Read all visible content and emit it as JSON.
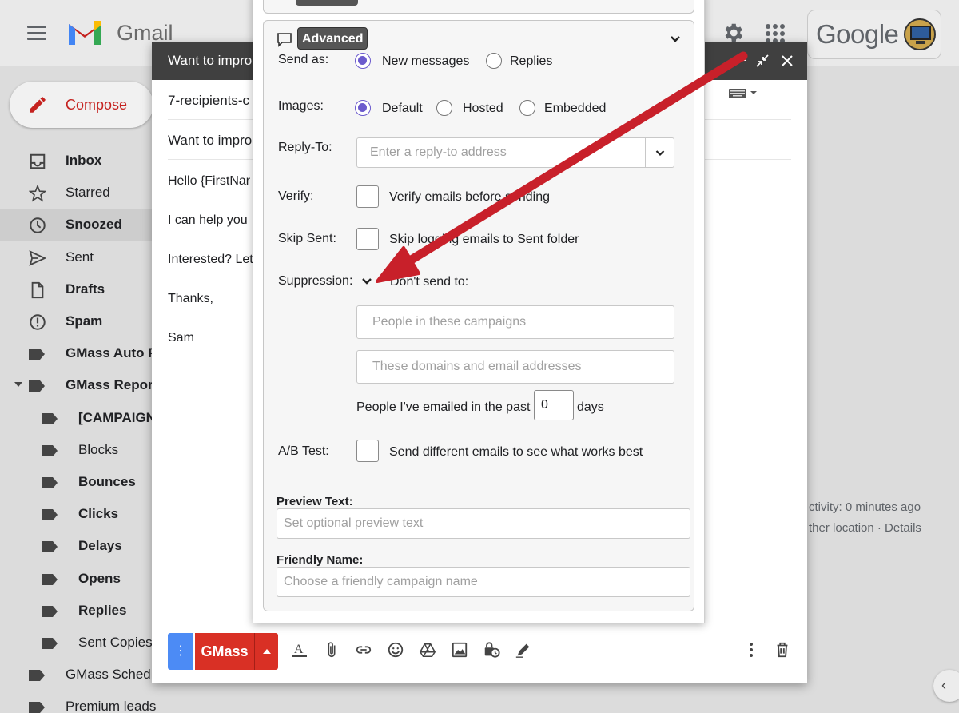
{
  "header": {
    "app_name": "Gmail",
    "google_word": "Google"
  },
  "sidebar": {
    "compose_label": "Compose",
    "items": [
      {
        "label": "Inbox",
        "bold": true
      },
      {
        "label": "Starred",
        "bold": false
      },
      {
        "label": "Snoozed",
        "bold": true
      },
      {
        "label": "Sent",
        "bold": false
      },
      {
        "label": "Drafts",
        "bold": true
      },
      {
        "label": "Spam",
        "bold": true
      },
      {
        "label": "GMass Auto F",
        "bold": true
      },
      {
        "label": "GMass Repor",
        "bold": true
      },
      {
        "label": "[CAMPAIGN",
        "bold": true
      },
      {
        "label": "Blocks",
        "bold": false
      },
      {
        "label": "Bounces",
        "bold": true
      },
      {
        "label": "Clicks",
        "bold": true
      },
      {
        "label": "Delays",
        "bold": true
      },
      {
        "label": "Opens",
        "bold": true
      },
      {
        "label": "Replies",
        "bold": true
      },
      {
        "label": "Sent Copies",
        "bold": false
      },
      {
        "label": "GMass Sched",
        "bold": false
      },
      {
        "label": "Premium leads",
        "bold": false
      }
    ]
  },
  "main": {
    "activity_text": "ctivity: 0 minutes ago",
    "location_text": "ther location · Details"
  },
  "compose": {
    "title": "Want to impro",
    "to_value": "7-recipients-c",
    "subject_value": "Want to impro",
    "body_lines": [
      "Hello {FirstNar",
      "I can help you",
      "Interested? Let",
      "Thanks,",
      "Sam"
    ],
    "toolbar": {
      "more_label": "⋮",
      "gmass_label": "GMass"
    }
  },
  "gmass_panel": {
    "advanced_label": "Advanced",
    "send_as": {
      "label": "Send as:",
      "options": [
        "New messages",
        "Replies"
      ],
      "selected": "New messages"
    },
    "images": {
      "label": "Images:",
      "options": [
        "Default",
        "Hosted",
        "Embedded"
      ],
      "selected": "Default"
    },
    "reply_to": {
      "label": "Reply-To:",
      "placeholder": "Enter a reply-to address"
    },
    "verify": {
      "label": "Verify:",
      "text": "Verify emails before sending",
      "checked": false
    },
    "skip_sent": {
      "label": "Skip Sent:",
      "text": "Skip logging emails to Sent folder",
      "checked": false
    },
    "suppression": {
      "label": "Suppression:",
      "title": "Don't send to:",
      "campaigns_placeholder": "People in these campaigns",
      "domains_placeholder": "These domains and email addresses",
      "past_prefix": "People I've emailed in the past",
      "past_value": "0",
      "past_suffix": "days"
    },
    "ab_test": {
      "label": "A/B Test:",
      "text": "Send different emails to see what works best",
      "checked": false
    },
    "preview_text": {
      "label": "Preview Text:",
      "placeholder": "Set optional preview text"
    },
    "friendly_name": {
      "label": "Friendly Name:",
      "placeholder": "Choose a friendly campaign name"
    }
  },
  "colors": {
    "radio_accent": "#6b5acd",
    "gmass_red": "#d93025",
    "annotation_arrow": "#c8202a",
    "more_blue": "#4c8bf5"
  }
}
